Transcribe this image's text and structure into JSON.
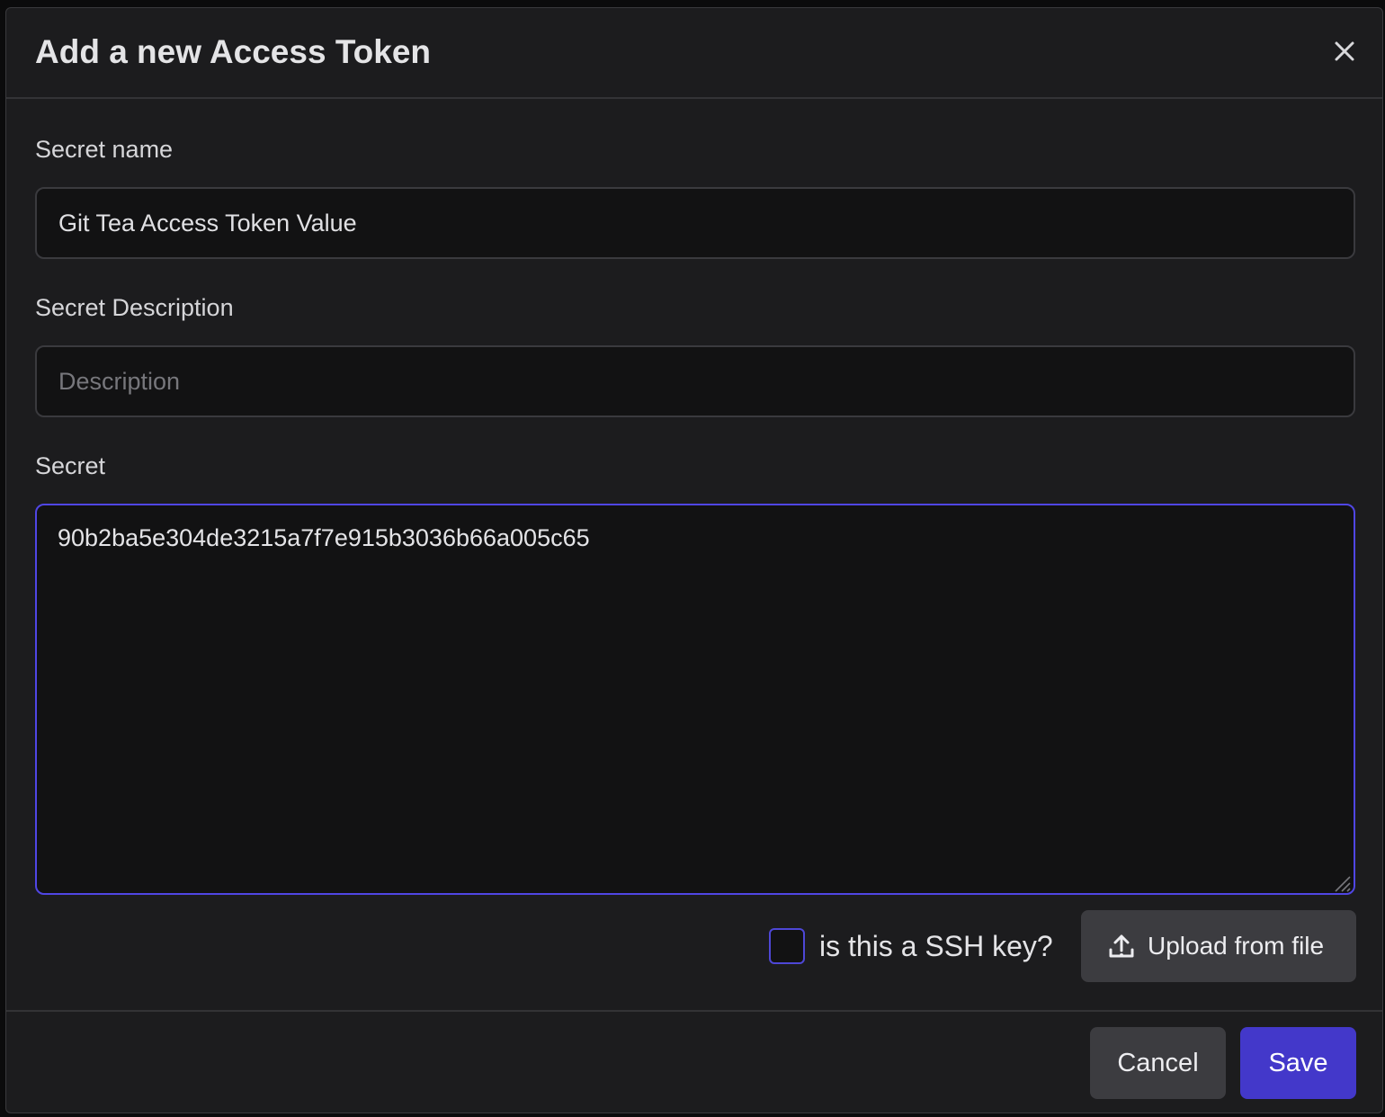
{
  "dialog": {
    "title": "Add a new Access Token",
    "close_icon": "close-icon"
  },
  "form": {
    "secret_name": {
      "label": "Secret name",
      "value": "Git Tea Access Token Value"
    },
    "secret_description": {
      "label": "Secret Description",
      "value": "",
      "placeholder": "Description"
    },
    "secret": {
      "label": "Secret",
      "value": "90b2ba5e304de3215a7f7e915b3036b66a005c65"
    },
    "ssh_key": {
      "label": "is this a SSH key?",
      "checked": false
    },
    "upload": {
      "label": "Upload from file",
      "icon": "upload-icon"
    }
  },
  "footer": {
    "cancel_label": "Cancel",
    "save_label": "Save"
  },
  "colors": {
    "background": "#1c1c1e",
    "accent": "#4338ca",
    "focus_border": "#5046e4",
    "secondary_button": "#3c3c40"
  }
}
